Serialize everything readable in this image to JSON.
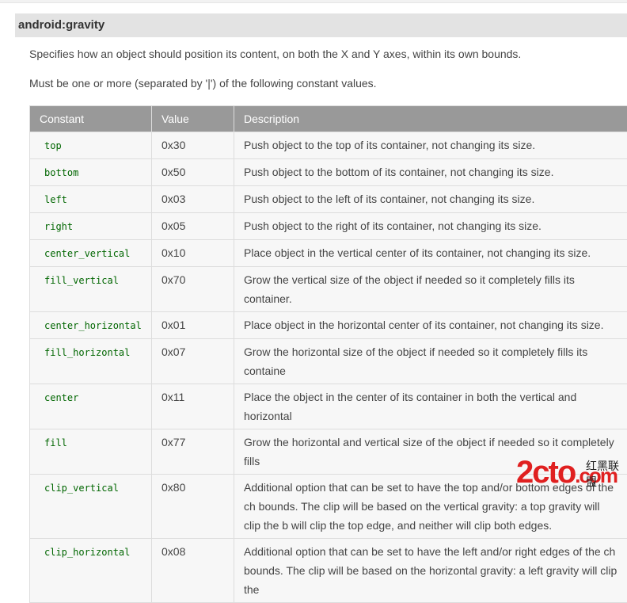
{
  "attribute": {
    "title": "android:gravity"
  },
  "intro": "Specifies how an object should position its content, on both the X and Y axes, within its own bounds.",
  "must_be": "Must be one or more (separated by '|') of the following constant values.",
  "table": {
    "headers": [
      "Constant",
      "Value",
      "Description"
    ],
    "rows": [
      {
        "constant": "top",
        "value": "0x30",
        "description": "Push object to the top of its container, not changing its size."
      },
      {
        "constant": "bottom",
        "value": "0x50",
        "description": "Push object to the bottom of its container, not changing its size."
      },
      {
        "constant": "left",
        "value": "0x03",
        "description": "Push object to the left of its container, not changing its size."
      },
      {
        "constant": "right",
        "value": "0x05",
        "description": "Push object to the right of its container, not changing its size."
      },
      {
        "constant": "center_vertical",
        "value": "0x10",
        "description": "Place object in the vertical center of its container, not changing its size."
      },
      {
        "constant": "fill_vertical",
        "value": "0x70",
        "description": "Grow the vertical size of the object if needed so it completely fills its container."
      },
      {
        "constant": "center_horizontal",
        "value": "0x01",
        "description": "Place object in the horizontal center of its container, not changing its size."
      },
      {
        "constant": "fill_horizontal",
        "value": "0x07",
        "description": "Grow the horizontal size of the object if needed so it completely fills its containe"
      },
      {
        "constant": "center",
        "value": "0x11",
        "description": "Place the object in the center of its container in both the vertical and horizontal"
      },
      {
        "constant": "fill",
        "value": "0x77",
        "description": "Grow the horizontal and vertical size of the object if needed so it completely fills"
      },
      {
        "constant": "clip_vertical",
        "value": "0x80",
        "description": "Additional option that can be set to have the top and/or bottom edges of the ch bounds. The clip will be based on the vertical gravity: a top gravity will clip the b will clip the top edge, and neither will clip both edges."
      },
      {
        "constant": "clip_horizontal",
        "value": "0x08",
        "description": "Additional option that can be set to have the left and/or right edges of the ch bounds. The clip will be based on the horizontal gravity: a left gravity will clip the"
      }
    ]
  },
  "watermark": {
    "logo": "2cto.com",
    "text": "红黑联盟"
  }
}
